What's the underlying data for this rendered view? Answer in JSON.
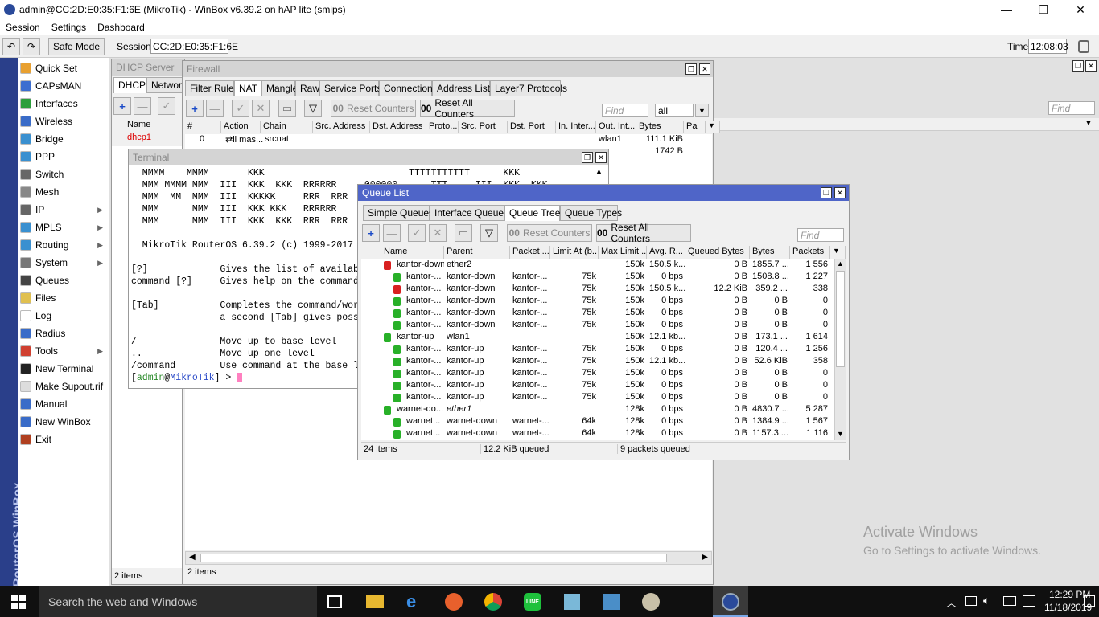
{
  "app": {
    "title": "admin@CC:2D:E0:35:F1:6E (MikroTik) - WinBox v6.39.2 on hAP lite (smips)"
  },
  "menu": [
    "Session",
    "Settings",
    "Dashboard"
  ],
  "toolbar": {
    "safe_mode": "Safe Mode",
    "session_label": "Session:",
    "session_value": "CC:2D:E0:35:F1:6E",
    "time_label": "Time:",
    "time_value": "12:08:03"
  },
  "brand": "RouterOS WinBox",
  "sidebar": [
    {
      "label": "Quick Set",
      "color": "#e8a030",
      "arrow": false
    },
    {
      "label": "CAPsMAN",
      "color": "#3c6ed0",
      "arrow": false
    },
    {
      "label": "Interfaces",
      "color": "#2c9e3c",
      "arrow": false
    },
    {
      "label": "Wireless",
      "color": "#3a6cc8",
      "arrow": false
    },
    {
      "label": "Bridge",
      "color": "#3a90d0",
      "arrow": false
    },
    {
      "label": "PPP",
      "color": "#3a90d0",
      "arrow": false
    },
    {
      "label": "Switch",
      "color": "#666666",
      "arrow": false
    },
    {
      "label": "Mesh",
      "color": "#888888",
      "arrow": false
    },
    {
      "label": "IP",
      "color": "#666666",
      "arrow": true
    },
    {
      "label": "MPLS",
      "color": "#3a90d0",
      "arrow": true
    },
    {
      "label": "Routing",
      "color": "#3a90d0",
      "arrow": true
    },
    {
      "label": "System",
      "color": "#777777",
      "arrow": true
    },
    {
      "label": "Queues",
      "color": "#444444",
      "arrow": false
    },
    {
      "label": "Files",
      "color": "#e0c050",
      "arrow": false
    },
    {
      "label": "Log",
      "color": "#ffffff",
      "arrow": false
    },
    {
      "label": "Radius",
      "color": "#3a6cc8",
      "arrow": false
    },
    {
      "label": "Tools",
      "color": "#d04030",
      "arrow": true
    },
    {
      "label": "New Terminal",
      "color": "#222222",
      "arrow": false
    },
    {
      "label": "Make Supout.rif",
      "color": "#dddddd",
      "arrow": false
    },
    {
      "label": "Manual",
      "color": "#3a6cc8",
      "arrow": false
    },
    {
      "label": "New WinBox",
      "color": "#3a6cc8",
      "arrow": false
    },
    {
      "label": "Exit",
      "color": "#b04020",
      "arrow": false
    }
  ],
  "dhcp": {
    "title": "DHCP Server",
    "tabs": [
      "DHCP",
      "Network"
    ],
    "col_name": "Name",
    "row": "dhcp1",
    "status": "2 items",
    "find": "Find"
  },
  "firewall": {
    "title": "Firewall",
    "tabs": [
      "Filter Rules",
      "NAT",
      "Mangle",
      "Raw",
      "Service Ports",
      "Connections",
      "Address Lists",
      "Layer7 Protocols"
    ],
    "reset_counters": "Reset Counters",
    "reset_all": "Reset All Counters",
    "find": "Find",
    "filter": "all",
    "cols": [
      "#",
      "Action",
      "Chain",
      "Src. Address",
      "Dst. Address",
      "Proto...",
      "Src. Port",
      "Dst. Port",
      "In. Inter...",
      "Out. Int...",
      "Bytes",
      "Pa"
    ],
    "row0": {
      "num": "0",
      "action": "mas...",
      "chain": "srcnat",
      "out": "wlan1",
      "bytes": "111.1 KiB"
    },
    "row1_bytes": "1742 B",
    "status": "2 items"
  },
  "terminal": {
    "title": "Terminal",
    "lines": [
      "  MMMM    MMMM       KKK                          TTTTTTTTTTT      KKK",
      "  MMM MMMM MMM  III  KKK  KKK  RRRRRR     000000      TTT     III  KKK  KKK",
      "  MMM  MM  MMM  III  KKKKK     RRR  RRR  000  000     TTT     III  KKKKK",
      "  MMM      MMM  III  KKK KKK   RRRRRR    000  000     TTT     III  KKK KKK",
      "  MMM      MMM  III  KKK  KKK  RRR  RRR   000000      TTT     III  KKK  KKK",
      "",
      "  MikroTik RouterOS 6.39.2 (c) 1999-2017",
      "",
      "[?]             Gives the list of available commands",
      "command [?]     Gives help on the command and list of arguments",
      "",
      "[Tab]           Completes the command/word. If the input is ambiguous,",
      "                a second [Tab] gives possible options",
      "",
      "/               Move up to base level",
      "..              Move up one level",
      "/command        Use command at the base level"
    ],
    "prompt_user": "admin",
    "prompt_host": "MikroTik",
    "prompt_tail": "] > "
  },
  "queue": {
    "title": "Queue List",
    "tabs": [
      "Simple Queues",
      "Interface Queues",
      "Queue Tree",
      "Queue Types"
    ],
    "reset_counters": "Reset Counters",
    "reset_all": "Reset All Counters",
    "find": "Find",
    "cols": [
      "Name",
      "Parent",
      "Packet ...",
      "Limit At (b...",
      "Max Limit ...",
      "Avg. R...",
      "Queued Bytes",
      "Bytes",
      "Packets"
    ],
    "rows": [
      {
        "indent": 0,
        "icon": "red",
        "name": "kantor-down",
        "parent": "ether2",
        "packet": "",
        "limit": "",
        "max": "150k",
        "avg": "150.5 k...",
        "queued": "0 B",
        "bytes": "1855.7 ...",
        "packets": "1 556"
      },
      {
        "indent": 1,
        "icon": "green",
        "name": "kantor-...",
        "parent": "kantor-down",
        "packet": "kantor-...",
        "limit": "75k",
        "max": "150k",
        "avg": "0 bps",
        "queued": "0 B",
        "bytes": "1508.8 ...",
        "packets": "1 227"
      },
      {
        "indent": 1,
        "icon": "red",
        "name": "kantor-...",
        "parent": "kantor-down",
        "packet": "kantor-...",
        "limit": "75k",
        "max": "150k",
        "avg": "150.5 k...",
        "queued": "12.2 KiB",
        "bytes": "359.2 ...",
        "packets": "338"
      },
      {
        "indent": 1,
        "icon": "green",
        "name": "kantor-...",
        "parent": "kantor-down",
        "packet": "kantor-...",
        "limit": "75k",
        "max": "150k",
        "avg": "0 bps",
        "queued": "0 B",
        "bytes": "0 B",
        "packets": "0"
      },
      {
        "indent": 1,
        "icon": "green",
        "name": "kantor-...",
        "parent": "kantor-down",
        "packet": "kantor-...",
        "limit": "75k",
        "max": "150k",
        "avg": "0 bps",
        "queued": "0 B",
        "bytes": "0 B",
        "packets": "0"
      },
      {
        "indent": 1,
        "icon": "green",
        "name": "kantor-...",
        "parent": "kantor-down",
        "packet": "kantor-...",
        "limit": "75k",
        "max": "150k",
        "avg": "0 bps",
        "queued": "0 B",
        "bytes": "0 B",
        "packets": "0"
      },
      {
        "indent": 0,
        "icon": "green",
        "name": "kantor-up",
        "parent": "wlan1",
        "packet": "",
        "limit": "",
        "max": "150k",
        "avg": "12.1 kb...",
        "queued": "0 B",
        "bytes": "173.1 ...",
        "packets": "1 614"
      },
      {
        "indent": 1,
        "icon": "green",
        "name": "kantor-...",
        "parent": "kantor-up",
        "packet": "kantor-...",
        "limit": "75k",
        "max": "150k",
        "avg": "0 bps",
        "queued": "0 B",
        "bytes": "120.4 ...",
        "packets": "1 256"
      },
      {
        "indent": 1,
        "icon": "green",
        "name": "kantor-...",
        "parent": "kantor-up",
        "packet": "kantor-...",
        "limit": "75k",
        "max": "150k",
        "avg": "12.1 kb...",
        "queued": "0 B",
        "bytes": "52.6 KiB",
        "packets": "358"
      },
      {
        "indent": 1,
        "icon": "green",
        "name": "kantor-...",
        "parent": "kantor-up",
        "packet": "kantor-...",
        "limit": "75k",
        "max": "150k",
        "avg": "0 bps",
        "queued": "0 B",
        "bytes": "0 B",
        "packets": "0"
      },
      {
        "indent": 1,
        "icon": "green",
        "name": "kantor-...",
        "parent": "kantor-up",
        "packet": "kantor-...",
        "limit": "75k",
        "max": "150k",
        "avg": "0 bps",
        "queued": "0 B",
        "bytes": "0 B",
        "packets": "0"
      },
      {
        "indent": 1,
        "icon": "green",
        "name": "kantor-...",
        "parent": "kantor-up",
        "packet": "kantor-...",
        "limit": "75k",
        "max": "150k",
        "avg": "0 bps",
        "queued": "0 B",
        "bytes": "0 B",
        "packets": "0"
      },
      {
        "indent": 0,
        "icon": "green",
        "name": "warnet-do...",
        "parent": "ether1",
        "packet": "",
        "limit": "",
        "max": "128k",
        "avg": "0 bps",
        "queued": "0 B",
        "bytes": "4830.7 ...",
        "packets": "5 287"
      },
      {
        "indent": 1,
        "icon": "green",
        "name": "warnet...",
        "parent": "warnet-down",
        "packet": "warnet-...",
        "limit": "64k",
        "max": "128k",
        "avg": "0 bps",
        "queued": "0 B",
        "bytes": "1384.9 ...",
        "packets": "1 567"
      },
      {
        "indent": 1,
        "icon": "green",
        "name": "warnet...",
        "parent": "warnet-down",
        "packet": "warnet-...",
        "limit": "64k",
        "max": "128k",
        "avg": "0 bps",
        "queued": "0 B",
        "bytes": "1157.3 ...",
        "packets": "1 116"
      }
    ],
    "status_items": "24 items",
    "status_queued": "12.2 KiB queued",
    "status_packets": "9 packets queued"
  },
  "right_find": "Find",
  "activate": {
    "line1": "Activate Windows",
    "line2": "Go to Settings to activate Windows."
  },
  "taskbar": {
    "search": "Search the web and Windows",
    "time": "12:29 PM",
    "date": "11/18/2019"
  }
}
